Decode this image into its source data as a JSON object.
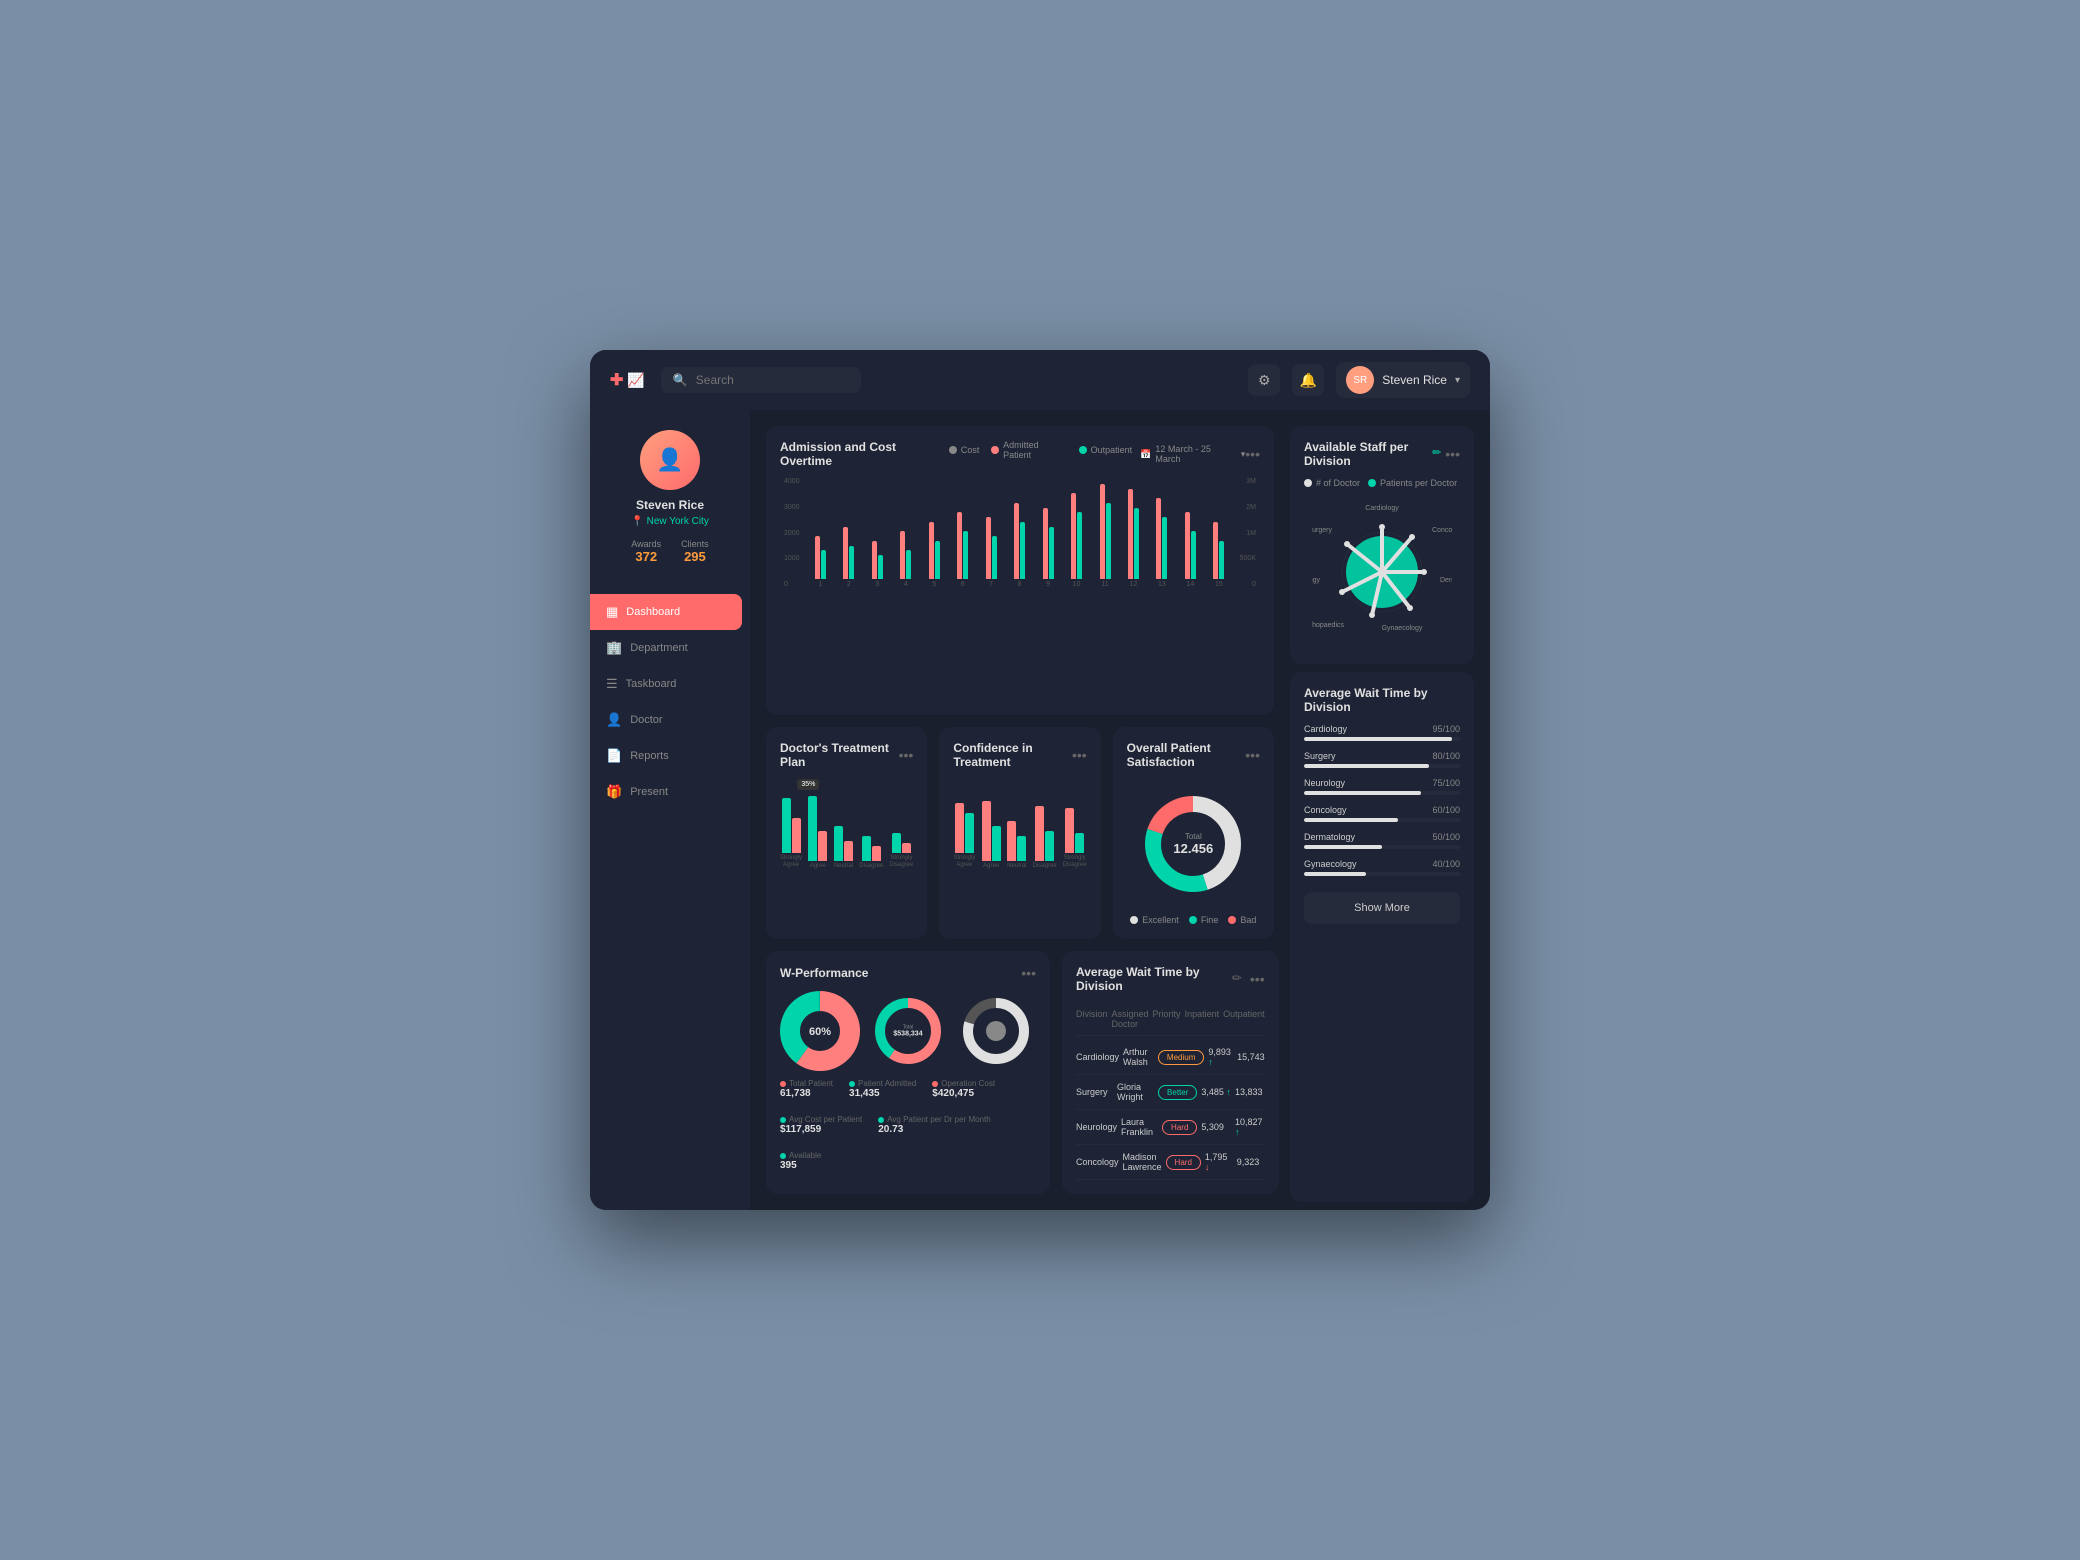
{
  "app": {
    "logo_cross": "✚",
    "logo_chart": "📈"
  },
  "topbar": {
    "search_placeholder": "Search",
    "user_name": "Steven Rice",
    "settings_icon": "⚙",
    "bell_icon": "🔔",
    "chevron": "▾"
  },
  "sidebar": {
    "profile": {
      "name": "Steven Rice",
      "city": "New York City",
      "awards_label": "Awards",
      "awards_value": "372",
      "clients_label": "Clients",
      "clients_value": "295"
    },
    "nav": [
      {
        "id": "dashboard",
        "label": "Dashboard",
        "icon": "▦",
        "active": true
      },
      {
        "id": "department",
        "label": "Department",
        "icon": "🏢",
        "active": false
      },
      {
        "id": "taskboard",
        "label": "Taskboard",
        "icon": "☰",
        "active": false
      },
      {
        "id": "doctor",
        "label": "Doctor",
        "icon": "👤",
        "active": false
      },
      {
        "id": "reports",
        "label": "Reports",
        "icon": "📄",
        "active": false
      },
      {
        "id": "present",
        "label": "Present",
        "icon": "🎁",
        "active": false
      }
    ]
  },
  "admission_chart": {
    "title": "Admission and Cost Overtime",
    "legend": [
      {
        "label": "Cost",
        "color": "#666"
      },
      {
        "label": "Admitted Patient",
        "color": "#ff7f7f"
      },
      {
        "label": "Outpatient",
        "color": "#00d4aa"
      }
    ],
    "date_filter": "12 March - 25 March",
    "bars": [
      {
        "x": 1,
        "admitted": 45,
        "outpatient": 30
      },
      {
        "x": 2,
        "admitted": 55,
        "outpatient": 35
      },
      {
        "x": 3,
        "admitted": 40,
        "outpatient": 25
      },
      {
        "x": 4,
        "admitted": 50,
        "outpatient": 30
      },
      {
        "x": 5,
        "admitted": 60,
        "outpatient": 40
      },
      {
        "x": 6,
        "admitted": 70,
        "outpatient": 50
      },
      {
        "x": 7,
        "admitted": 65,
        "outpatient": 45
      },
      {
        "x": 8,
        "admitted": 80,
        "outpatient": 60
      },
      {
        "x": 9,
        "admitted": 75,
        "outpatient": 55
      },
      {
        "x": 10,
        "admitted": 90,
        "outpatient": 70
      },
      {
        "x": 11,
        "admitted": 100,
        "outpatient": 80
      },
      {
        "x": 12,
        "admitted": 95,
        "outpatient": 75
      },
      {
        "x": 13,
        "admitted": 85,
        "outpatient": 65
      },
      {
        "x": 14,
        "admitted": 70,
        "outpatient": 50
      },
      {
        "x": 15,
        "admitted": 60,
        "outpatient": 40
      }
    ]
  },
  "treatment_chart": {
    "title": "Doctor's Treatment Plan",
    "tooltip": "35%",
    "bars": [
      {
        "label": "Strongly\nAgree",
        "val1": 55,
        "val2": 45
      },
      {
        "label": "Agree",
        "val1": 65,
        "val2": 30
      },
      {
        "label": "Neutral",
        "val1": 35,
        "val2": 20
      },
      {
        "label": "Disagree",
        "val1": 25,
        "val2": 15
      },
      {
        "label": "Strongly\nDisagree",
        "val1": 20,
        "val2": 10
      }
    ]
  },
  "confidence_chart": {
    "title": "Confidence in Treatment",
    "bars": [
      {
        "label": "Strongly\nAgree",
        "val1": 50,
        "val2": 40
      },
      {
        "label": "Agree",
        "val1": 60,
        "val2": 35
      },
      {
        "label": "Neutral",
        "val1": 40,
        "val2": 25
      },
      {
        "label": "Disagree",
        "val1": 55,
        "val2": 30
      },
      {
        "label": "Strongly\nDisagree",
        "val1": 45,
        "val2": 20
      }
    ]
  },
  "satisfaction_chart": {
    "title": "Overall Patient Satisfaction",
    "total_label": "Total",
    "total_value": "12.456",
    "legend": [
      {
        "label": "Excellent",
        "color": "#fff"
      },
      {
        "label": "Fine",
        "color": "#00d4aa"
      },
      {
        "label": "Bad",
        "color": "#ff6b6b"
      }
    ],
    "segments": [
      {
        "pct": 45,
        "color": "#00d4aa"
      },
      {
        "pct": 35,
        "color": "#fff"
      },
      {
        "pct": 20,
        "color": "#ff6b6b"
      }
    ]
  },
  "wperf": {
    "title": "W-Performance",
    "donut1": {
      "pct": 60,
      "pct2": 40,
      "color1": "#ff7f7f",
      "color2": "#00d4aa"
    },
    "donut2": {
      "total_label": "Total",
      "total_value": "$538,334",
      "color1": "#ff7f7f",
      "color2": "#00d4aa"
    },
    "donut3": {
      "color1": "#e0e0e0",
      "color2": "#555"
    },
    "stats": [
      {
        "dot": "#ff6b6b",
        "label": "Total Patient",
        "value": "61,738"
      },
      {
        "dot": "#00d4aa",
        "label": "Patient Admitted",
        "value": "31,435"
      },
      {
        "dot": "#ff6b6b",
        "label": "Operation Cost",
        "value": "$420,475"
      },
      {
        "dot": "#00d4aa",
        "label": "Avg Cost per Patient",
        "value": "$117,859"
      },
      {
        "dot": "#00d4aa",
        "label": "Avg Patient per Dr per Month",
        "value": "20.73"
      },
      {
        "dot": "#00d4aa",
        "label": "Available",
        "value": "395"
      }
    ]
  },
  "wait_table": {
    "title": "Average Wait Time by Division",
    "headers": [
      "Division",
      "Assigned Doctor",
      "Priority",
      "Inpatient",
      "Outpatient"
    ],
    "rows": [
      {
        "division": "Cardiology",
        "doctor": "Arthur Walsh",
        "priority": "Medium",
        "priority_class": "medium",
        "inpatient": "9,893",
        "trend_in": "up",
        "outpatient": "15,743"
      },
      {
        "division": "Surgery",
        "doctor": "Gloria Wright",
        "priority": "Better",
        "priority_class": "better",
        "inpatient": "3,485",
        "trend_in": "up",
        "outpatient": "13,833"
      },
      {
        "division": "Neurology",
        "doctor": "Laura Franklin",
        "priority": "Hard",
        "priority_class": "hard",
        "inpatient": "5,309",
        "trend_in": "",
        "outpatient": "10,827",
        "trend_out": "up"
      },
      {
        "division": "Concology",
        "doctor": "Madison Lawrence",
        "priority": "Hard",
        "priority_class": "hard",
        "inpatient": "1,795",
        "trend_in": "down",
        "outpatient": "9,323"
      }
    ]
  },
  "available_staff": {
    "title": "Available Staff per Division",
    "legend": [
      {
        "label": "# of Doctor",
        "color": "#fff"
      },
      {
        "label": "Patients per Doctor",
        "color": "#00d4aa"
      }
    ],
    "divisions": [
      "Cardiology",
      "Concology",
      "Dermatology",
      "Gynaecology",
      "Orthopaedics",
      "Neurology",
      "Surgery"
    ]
  },
  "avg_wait_right": {
    "title": "Average Wait Time by Division",
    "items": [
      {
        "name": "Cardiology",
        "score": "95/100",
        "pct": 95
      },
      {
        "name": "Surgery",
        "score": "80/100",
        "pct": 80
      },
      {
        "name": "Neurology",
        "score": "75/100",
        "pct": 75
      },
      {
        "name": "Concology",
        "score": "60/100",
        "pct": 60
      },
      {
        "name": "Dermatology",
        "score": "50/100",
        "pct": 50
      },
      {
        "name": "Gynaecology",
        "score": "40/100",
        "pct": 40
      }
    ],
    "show_more": "Show More"
  }
}
